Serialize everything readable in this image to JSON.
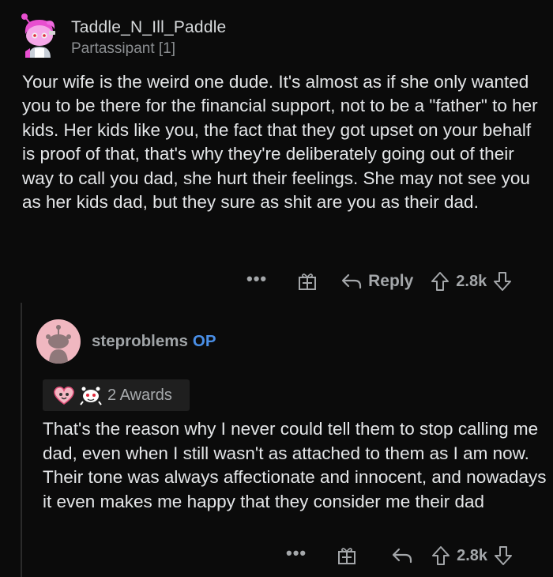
{
  "comment1": {
    "username": "Taddle_N_Ill_Paddle",
    "flair": "Partassipant [1]",
    "body": "Your wife is the weird one dude. It's almost as if she only wanted you to be there for the financial support, not to be a \"father\" to her kids. Her kids like you, the fact that they got upset on your behalf is proof of that, that's why they're deliberately going out of their way to call you dad, she hurt their feelings. She may not see you as her kids dad, but they sure as shit are you as their dad.",
    "actions": {
      "more": "•••",
      "reply_label": "Reply",
      "score": "2.8k"
    }
  },
  "comment2": {
    "username": "steproblems",
    "op_badge": "OP",
    "awards_label": "2 Awards",
    "body": "That's the reason why I never could tell them to stop calling me dad, even when I still wasn't as attached to them as I am now. Their tone was always affectionate and innocent, and nowadays it even makes me happy that they consider me their dad",
    "actions": {
      "more": "•••",
      "score": "2.8k"
    }
  },
  "colors": {
    "background": "#0b0b0b",
    "op_blue": "#4a8fe7",
    "avatar1_pink": "#e84fd0",
    "avatar2_pink": "#f0b7c0"
  },
  "icons": [
    "snoo-avatar-icon",
    "gift-icon",
    "reply-arrow-icon",
    "upvote-icon",
    "downvote-icon",
    "heart-award-icon",
    "wholesome-award-icon"
  ]
}
